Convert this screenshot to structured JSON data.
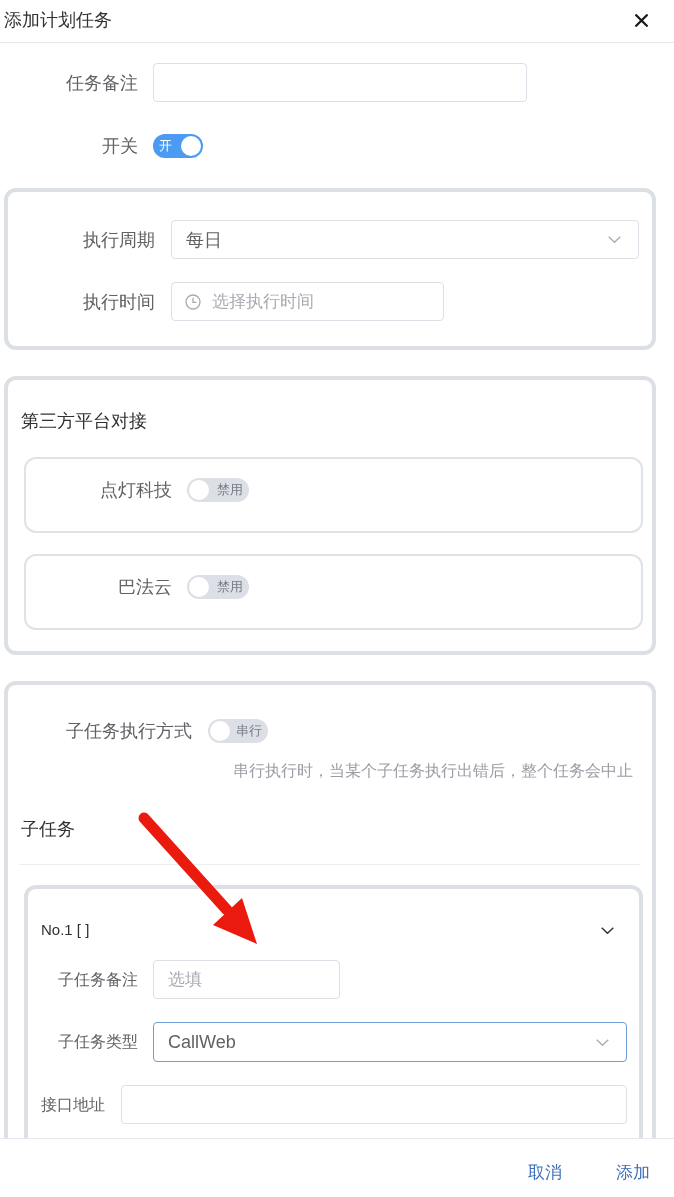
{
  "dialog": {
    "title": "添加计划任务"
  },
  "fields": [
    {
      "kind": "input",
      "label": "任务备注"
    },
    {
      "kind": "switch",
      "label": "开关",
      "on": true,
      "text": "开"
    }
  ],
  "schedule": {
    "fields": [
      {
        "kind": "select",
        "label": "执行周期",
        "value": "每日"
      },
      {
        "kind": "time",
        "label": "执行时间",
        "placeholder": "选择执行时间"
      }
    ]
  },
  "third_party": {
    "title": "第三方平台对接",
    "platforms": [
      {
        "label": "点灯科技",
        "on": false,
        "text": "禁用"
      },
      {
        "label": "巴法云",
        "on": false,
        "text": "禁用"
      }
    ]
  },
  "subtasks": {
    "mode": {
      "label": "子任务执行方式",
      "on": false,
      "text": "串行"
    },
    "hint": "串行执行时，当某个子任务执行出错后，整个任务会中止",
    "title": "子任务",
    "items": [
      {
        "heading": "No.1 [ ]",
        "fields": [
          {
            "kind": "input",
            "label": "子任务备注",
            "placeholder": "选填",
            "focused": false
          },
          {
            "kind": "select",
            "label": "子任务类型",
            "value": "CallWeb",
            "focused": true
          }
        ],
        "type_options": [
          {
            "kind": "input",
            "label": "接口地址",
            "focused": false
          }
        ]
      }
    ]
  },
  "footer": {
    "buttons": [
      "取消",
      "添加"
    ]
  }
}
